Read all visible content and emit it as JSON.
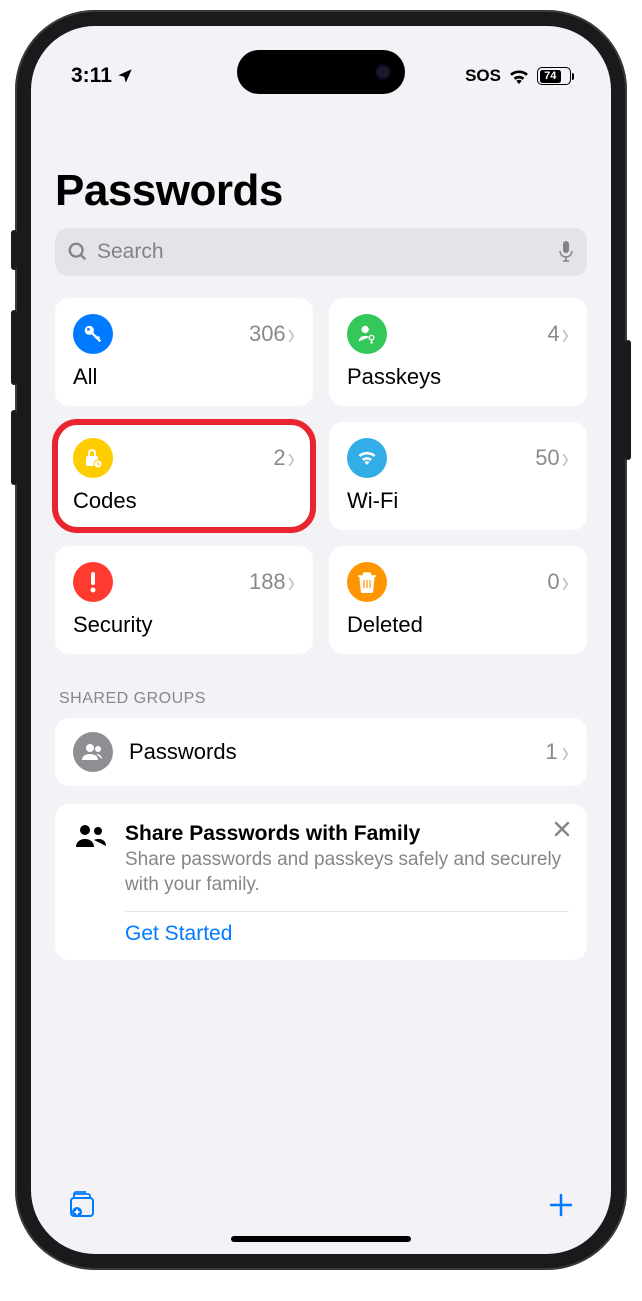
{
  "status": {
    "time": "3:11",
    "sos": "SOS",
    "battery": "74"
  },
  "title": "Passwords",
  "search": {
    "placeholder": "Search"
  },
  "tiles": [
    {
      "label": "All",
      "count": "306",
      "icon": "key",
      "color": "#007aff"
    },
    {
      "label": "Passkeys",
      "count": "4",
      "icon": "person-key",
      "color": "#34c759"
    },
    {
      "label": "Codes",
      "count": "2",
      "icon": "lock-clock",
      "color": "#ffcc00",
      "highlighted": true
    },
    {
      "label": "Wi-Fi",
      "count": "50",
      "icon": "wifi",
      "color": "#32ade6"
    },
    {
      "label": "Security",
      "count": "188",
      "icon": "exclaim",
      "color": "#ff3b30"
    },
    {
      "label": "Deleted",
      "count": "0",
      "icon": "trash",
      "color": "#ff9500"
    }
  ],
  "sharedGroups": {
    "header": "SHARED GROUPS",
    "items": [
      {
        "label": "Passwords",
        "count": "1"
      }
    ]
  },
  "promo": {
    "title": "Share Passwords with Family",
    "desc": "Share passwords and passkeys safely and securely with your family.",
    "action": "Get Started"
  }
}
